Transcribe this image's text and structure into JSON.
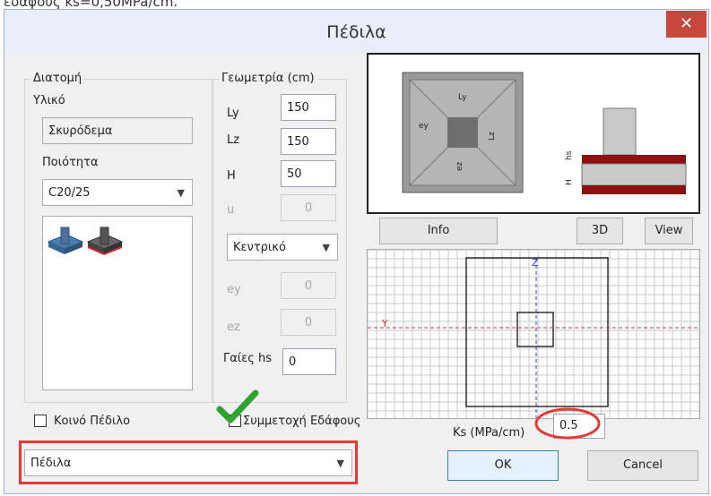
{
  "top_strip_text": "εδάφους ks=0,50MPa/cm.",
  "window": {
    "title": "Πέδιλα",
    "close_label": "✕"
  },
  "section_group": {
    "title": "Διατομή",
    "material_label": "Υλικό",
    "material_value": "Σκυρόδεμα",
    "quality_label": "Ποιότητα",
    "quality_value": "C20/25"
  },
  "geometry_group": {
    "title": "Γεωμετρία (cm)",
    "ly_label": "Ly",
    "ly_value": "150",
    "lz_label": "Lz",
    "lz_value": "150",
    "h_label": "H",
    "h_value": "50",
    "u_label": "u",
    "u_value": "0",
    "position_value": "Κεντρικό",
    "ey_label": "ey",
    "ey_value": "0",
    "ez_label": "ez",
    "ez_value": "0",
    "beams_label": "Γαίες hs",
    "beams_value": "0"
  },
  "preview_labels": {
    "ly": "Ly",
    "lz": "Lz",
    "ey": "ey",
    "ez": "ez",
    "h": "H",
    "hs": "hs"
  },
  "buttons": {
    "info": "Info",
    "three_d": "3D",
    "view": "View",
    "ok": "OK",
    "cancel": "Cancel"
  },
  "grid": {
    "y_axis": "Y",
    "z_axis": "Z"
  },
  "common_footing": {
    "label": "Κοινό Πέδιλο",
    "checked": false
  },
  "soil_participation": {
    "label": "Συμμετοχή Εδάφους",
    "checked": true
  },
  "ks": {
    "label": "Ks (MPa/cm)",
    "value": "0.5"
  },
  "bottom_combo_value": "Πέδιλα",
  "colors": {
    "annotation_red": "#e53935",
    "checkmark_green": "#2fa22f",
    "close_red": "#c9463d"
  }
}
